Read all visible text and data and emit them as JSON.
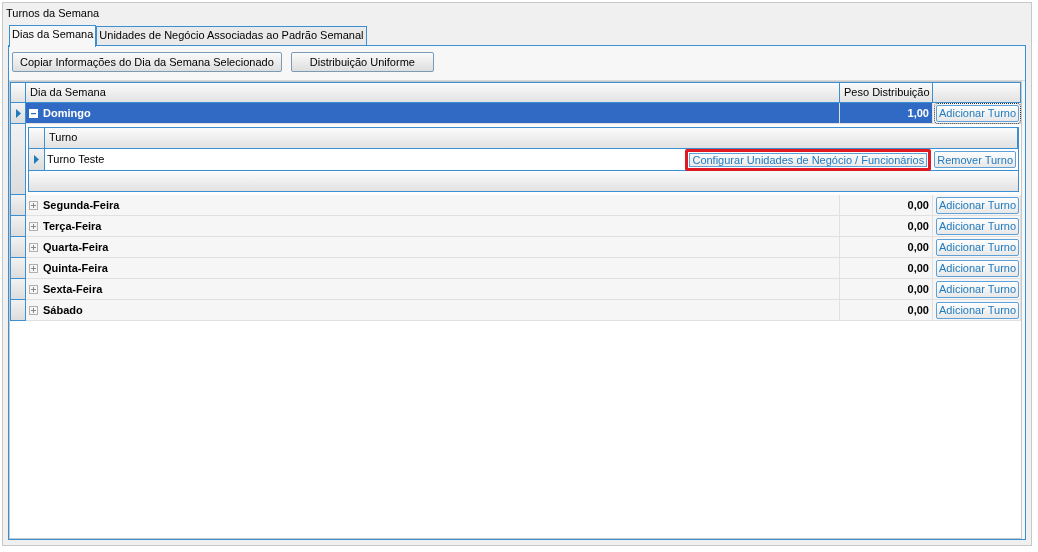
{
  "panel": {
    "title": "Turnos da Semana"
  },
  "tabs": [
    {
      "label": "Dias da Semana",
      "selected": true
    },
    {
      "label": "Unidades de Negócio Associadas ao Padrão Semanal",
      "selected": false
    }
  ],
  "toolbar": [
    "Copiar Informações do Dia da Semana Selecionado",
    "Distribuição Uniforme"
  ],
  "grid": {
    "columns": [
      "Dia da Semana",
      "Peso Distribuição"
    ],
    "rows": [
      {
        "day": "Domingo",
        "weight": "1,00",
        "action": "Adicionar Turno",
        "selected": true,
        "expanded": true,
        "detail": {
          "columns": [
            "Turno"
          ],
          "rows": [
            {
              "name": "Turno Teste",
              "current": true,
              "actions": [
                {
                  "label": "Configurar Unidades de Negócio / Funcionários",
                  "highlighted": true
                },
                {
                  "label": "Remover Turno",
                  "highlighted": false
                }
              ]
            }
          ]
        }
      },
      {
        "day": "Segunda-Feira",
        "weight": "0,00",
        "action": "Adicionar Turno",
        "selected": false,
        "expanded": false
      },
      {
        "day": "Terça-Feira",
        "weight": "0,00",
        "action": "Adicionar Turno",
        "selected": false,
        "expanded": false
      },
      {
        "day": "Quarta-Feira",
        "weight": "0,00",
        "action": "Adicionar Turno",
        "selected": false,
        "expanded": false
      },
      {
        "day": "Quinta-Feira",
        "weight": "0,00",
        "action": "Adicionar Turno",
        "selected": false,
        "expanded": false
      },
      {
        "day": "Sexta-Feira",
        "weight": "0,00",
        "action": "Adicionar Turno",
        "selected": false,
        "expanded": false
      },
      {
        "day": "Sábado",
        "weight": "0,00",
        "action": "Adicionar Turno",
        "selected": false,
        "expanded": false
      }
    ]
  }
}
